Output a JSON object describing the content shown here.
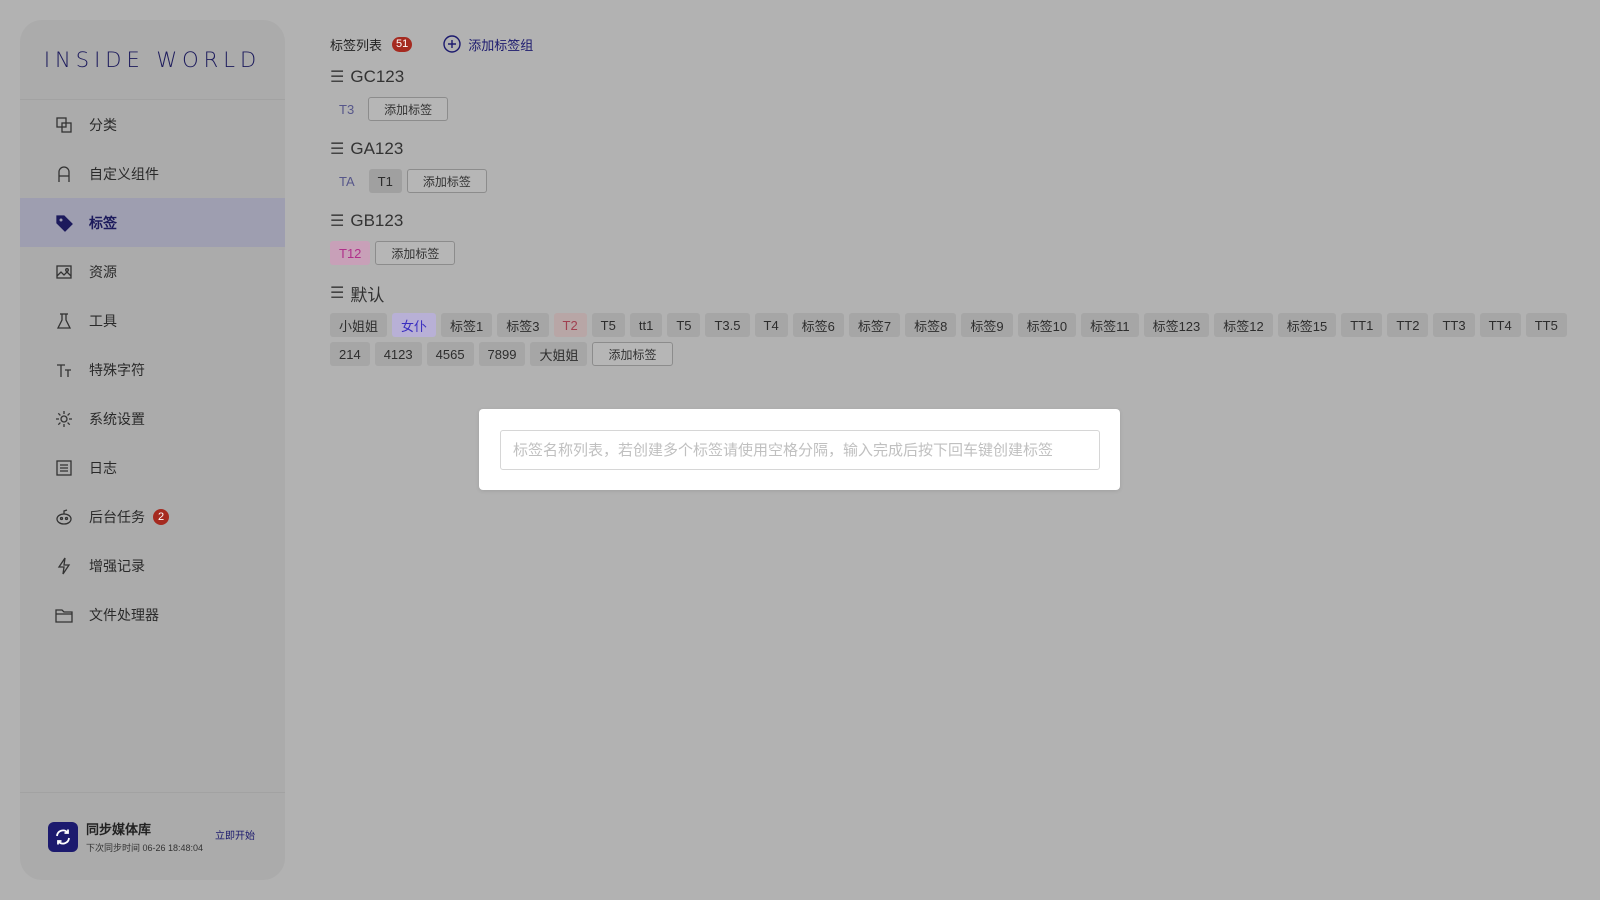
{
  "brand": {
    "logo_text": "INSIDE WORLD"
  },
  "sidebar": {
    "items": [
      {
        "label": "分类",
        "icon": "category-icon"
      },
      {
        "label": "自定义组件",
        "icon": "component-icon"
      },
      {
        "label": "标签",
        "icon": "tag-icon",
        "active": true
      },
      {
        "label": "资源",
        "icon": "image-icon"
      },
      {
        "label": "工具",
        "icon": "flask-icon"
      },
      {
        "label": "特殊字符",
        "icon": "text-icon"
      },
      {
        "label": "系统设置",
        "icon": "gear-icon"
      },
      {
        "label": "日志",
        "icon": "list-icon"
      },
      {
        "label": "后台任务",
        "icon": "robot-icon",
        "badge": "2"
      },
      {
        "label": "增强记录",
        "icon": "bolt-icon"
      },
      {
        "label": "文件处理器",
        "icon": "folder-icon"
      }
    ],
    "sync": {
      "title": "同步媒体库",
      "subtitle": "下次同步时间 06-26 18:48:04",
      "action": "立即开始"
    }
  },
  "main": {
    "header": {
      "title": "标签列表",
      "count": "51",
      "add_group_label": "添加标签组"
    },
    "add_tag_label": "添加标签",
    "groups": [
      {
        "name": "GC123",
        "tags": [
          {
            "text": "T3",
            "style": "plain"
          }
        ]
      },
      {
        "name": "GA123",
        "tags": [
          {
            "text": "TA",
            "style": "plain"
          },
          {
            "text": "T1",
            "style": "mid"
          }
        ]
      },
      {
        "name": "GB123",
        "tags": [
          {
            "text": "T12",
            "style": "pink"
          }
        ]
      },
      {
        "name": "默认",
        "tags": [
          {
            "text": "小姐姐",
            "style": ""
          },
          {
            "text": "女仆",
            "style": "lav"
          },
          {
            "text": "标签1",
            "style": ""
          },
          {
            "text": "标签3",
            "style": ""
          },
          {
            "text": "T2",
            "style": "rose"
          },
          {
            "text": "T5",
            "style": ""
          },
          {
            "text": "tt1",
            "style": ""
          },
          {
            "text": "T5",
            "style": ""
          },
          {
            "text": "T3.5",
            "style": ""
          },
          {
            "text": "T4",
            "style": ""
          },
          {
            "text": "标签6",
            "style": ""
          },
          {
            "text": "标签7",
            "style": ""
          },
          {
            "text": "标签8",
            "style": ""
          },
          {
            "text": "标签9",
            "style": ""
          },
          {
            "text": "标签10",
            "style": ""
          },
          {
            "text": "标签11",
            "style": ""
          },
          {
            "text": "标签123",
            "style": ""
          },
          {
            "text": "标签12",
            "style": ""
          },
          {
            "text": "标签15",
            "style": ""
          },
          {
            "text": "TT1",
            "style": ""
          },
          {
            "text": "TT2",
            "style": ""
          },
          {
            "text": "TT3",
            "style": ""
          },
          {
            "text": "TT4",
            "style": ""
          },
          {
            "text": "TT5",
            "style": ""
          },
          {
            "text": "214",
            "style": ""
          },
          {
            "text": "4123",
            "style": ""
          },
          {
            "text": "4565",
            "style": ""
          },
          {
            "text": "7899",
            "style": ""
          },
          {
            "text": "大姐姐",
            "style": ""
          }
        ]
      }
    ]
  },
  "modal": {
    "placeholder": "标签名称列表，若创建多个标签请使用空格分隔，输入完成后按下回车键创建标签",
    "value": ""
  }
}
